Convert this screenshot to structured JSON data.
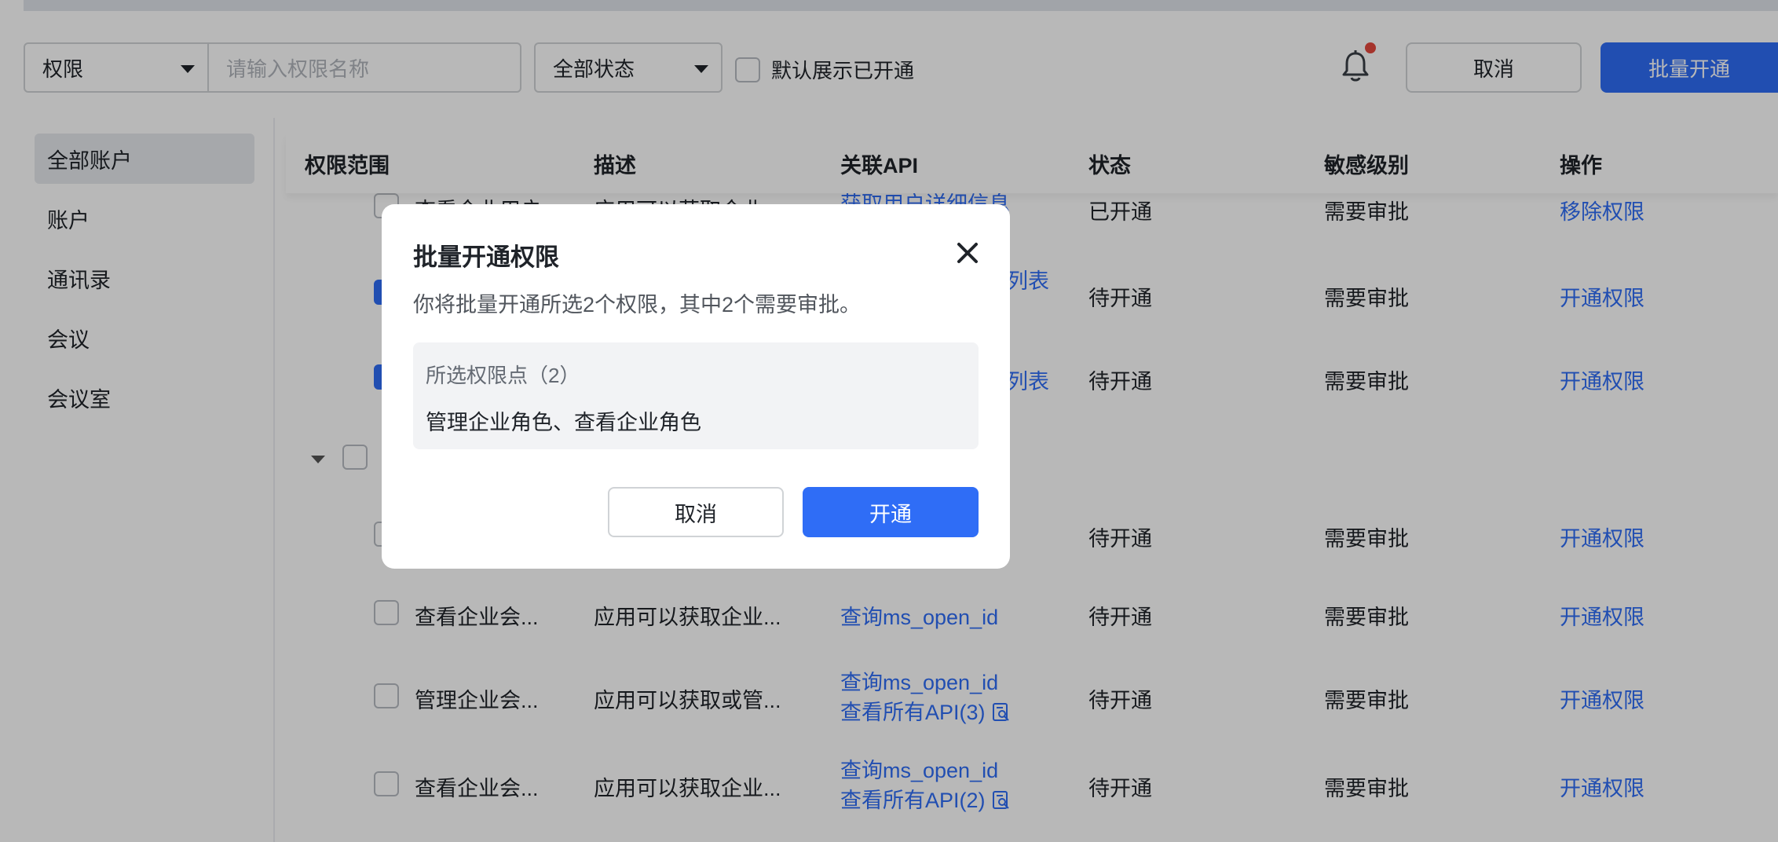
{
  "toolbar": {
    "filter_type": "权限",
    "search_placeholder": "请输入权限名称",
    "status_filter": "全部状态",
    "default_show_label": "默认展示已开通",
    "cancel_label": "取消",
    "batch_enable_label": "批量开通"
  },
  "sidebar": {
    "items": [
      {
        "label": "全部账户",
        "active": true
      },
      {
        "label": "账户"
      },
      {
        "label": "通讯录"
      },
      {
        "label": "会议"
      },
      {
        "label": "会议室"
      }
    ]
  },
  "table": {
    "headers": [
      "权限范围",
      "描述",
      "关联API",
      "状态",
      "敏感级别",
      "操作"
    ],
    "rows": [
      {
        "name": "查看企业用户",
        "desc": "应用可以获取企业...",
        "api": [
          "获取用户详细信息",
          ""
        ],
        "status": "已开通",
        "level": "需要审批",
        "action": "移除权限"
      },
      {
        "name": "",
        "desc": "",
        "api": [
          "列表",
          ""
        ],
        "status": "待开通",
        "level": "需要审批",
        "action": "开通权限"
      },
      {
        "name": "",
        "desc": "",
        "api": [
          "列表"
        ],
        "status": "待开通",
        "level": "需要审批",
        "action": "开通权限"
      },
      {
        "name": "",
        "desc": "",
        "api": [],
        "status": "待开通",
        "level": "需要审批",
        "action": "开通权限"
      },
      {
        "name": "查看企业会...",
        "desc": "应用可以获取企业...",
        "api": [
          "查询ms_open_id"
        ],
        "status": "待开通",
        "level": "需要审批",
        "action": "开通权限"
      },
      {
        "name": "管理企业会...",
        "desc": "应用可以获取或管...",
        "api": [
          "查询ms_open_id",
          "查看所有API(3)"
        ],
        "status": "待开通",
        "level": "需要审批",
        "action": "开通权限"
      },
      {
        "name": "查看企业会...",
        "desc": "应用可以获取企业...",
        "api": [
          "查询ms_open_id",
          "查看所有API(2)"
        ],
        "status": "待开通",
        "level": "需要审批",
        "action": "开通权限"
      }
    ]
  },
  "dialog": {
    "title": "批量开通权限",
    "description": "你将批量开通所选2个权限，其中2个需要审批。",
    "box_label": "所选权限点（2）",
    "box_value": "管理企业角色、查看企业角色",
    "cancel_label": "取消",
    "confirm_label": "开通"
  },
  "colors": {
    "primary": "#2f6df6",
    "notification_dot": "#e5483e"
  },
  "icons": {
    "close": "close-icon",
    "bell": "bell-icon",
    "doc": "document-search-icon",
    "dropdown": "chevron-down-icon"
  }
}
